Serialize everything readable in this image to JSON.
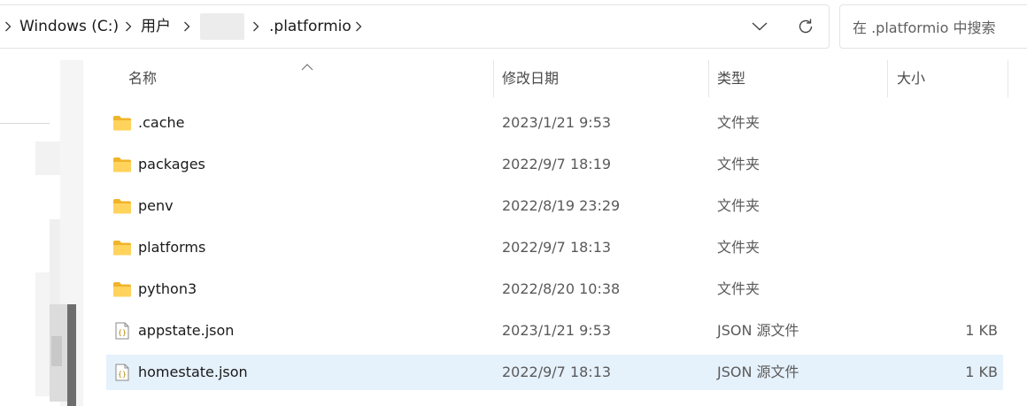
{
  "address_bar": {
    "crumbs": [
      "Windows (C:)",
      "用户",
      ".platformio"
    ],
    "dropdown_icon": "chevron-down-icon",
    "refresh_icon": "refresh-icon"
  },
  "search": {
    "placeholder": "在 .platformio 中搜索"
  },
  "columns": {
    "name": "名称",
    "modified": "修改日期",
    "type": "类型",
    "size": "大小"
  },
  "rows": [
    {
      "name": ".cache",
      "modified": "2023/1/21 9:53",
      "type": "文件夹",
      "size": "",
      "icon": "folder-icon"
    },
    {
      "name": "packages",
      "modified": "2022/9/7 18:19",
      "type": "文件夹",
      "size": "",
      "icon": "folder-icon"
    },
    {
      "name": "penv",
      "modified": "2022/8/19 23:29",
      "type": "文件夹",
      "size": "",
      "icon": "folder-icon"
    },
    {
      "name": "platforms",
      "modified": "2022/9/7 18:13",
      "type": "文件夹",
      "size": "",
      "icon": "folder-icon"
    },
    {
      "name": "python3",
      "modified": "2022/8/20 10:38",
      "type": "文件夹",
      "size": "",
      "icon": "folder-icon"
    },
    {
      "name": "appstate.json",
      "modified": "2023/1/21 9:53",
      "type": "JSON 源文件",
      "size": "1 KB",
      "icon": "json-file-icon"
    },
    {
      "name": "homestate.json",
      "modified": "2022/9/7 18:13",
      "type": "JSON 源文件",
      "size": "1 KB",
      "icon": "json-file-icon",
      "selected": true
    }
  ],
  "colors": {
    "selection": "#e5f1fb",
    "folder": "#f8c94a",
    "border": "#e3e3e3"
  }
}
